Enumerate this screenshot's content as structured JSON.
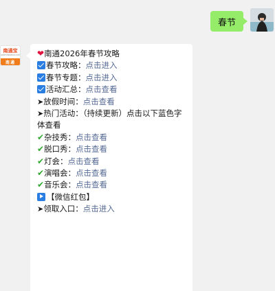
{
  "user_message": {
    "text": "春节"
  },
  "bot_avatar": {
    "brand": "南通宝",
    "sub": "NANTONGBAO.COM",
    "city": "南通"
  },
  "bot_message": {
    "title": "南通2026年春节攻略",
    "checklist": [
      {
        "label": "春节攻略：",
        "link": "点击进入"
      },
      {
        "label": "春节专题：",
        "link": "点击进入"
      },
      {
        "label": "活动汇总：",
        "link": "点击查看"
      }
    ],
    "holiday": {
      "label": "放假时间：",
      "link": "点击查看"
    },
    "hot_activities": "热门活动：（持续更新）点击以下蓝色字体查看",
    "activities": [
      {
        "label": "杂技秀：",
        "link": "点击查看"
      },
      {
        "label": "脱口秀：",
        "link": "点击查看"
      },
      {
        "label": "灯会：",
        "link": "点击查看"
      },
      {
        "label": "演唱会：",
        "link": "点击查看"
      },
      {
        "label": "音乐会：",
        "link": "点击查看"
      }
    ],
    "wechat_red_packet": "【微信红包】",
    "claim": {
      "label": "领取入口：",
      "link": "点击进入"
    },
    "bullet_arrow": "➤",
    "check_mark": "✔",
    "heart": "❤"
  }
}
